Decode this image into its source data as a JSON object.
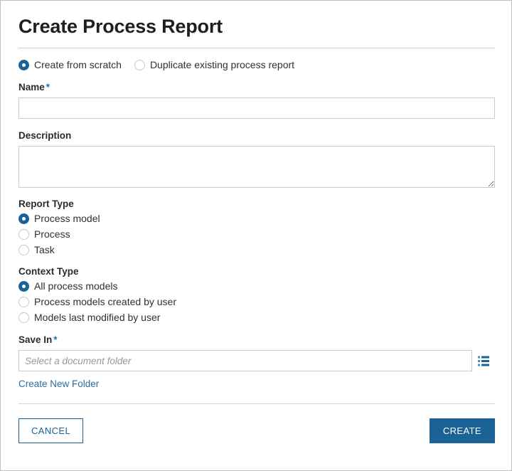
{
  "dialog": {
    "title": "Create Process Report"
  },
  "mode": {
    "options": [
      {
        "label": "Create from scratch",
        "selected": true
      },
      {
        "label": "Duplicate existing process report",
        "selected": false
      }
    ]
  },
  "name_field": {
    "label": "Name",
    "required_marker": "*",
    "value": "",
    "placeholder": ""
  },
  "description_field": {
    "label": "Description",
    "value": "",
    "placeholder": ""
  },
  "report_type": {
    "label": "Report Type",
    "options": [
      {
        "label": "Process model",
        "selected": true
      },
      {
        "label": "Process",
        "selected": false
      },
      {
        "label": "Task",
        "selected": false
      }
    ]
  },
  "context_type": {
    "label": "Context Type",
    "options": [
      {
        "label": "All process models",
        "selected": true
      },
      {
        "label": "Process models created by user",
        "selected": false
      },
      {
        "label": "Models last modified by user",
        "selected": false
      }
    ]
  },
  "save_in": {
    "label": "Save In",
    "required_marker": "*",
    "value": "",
    "placeholder": "Select a document folder",
    "picker_icon": "list-icon",
    "create_folder_link": "Create New Folder"
  },
  "footer": {
    "cancel_label": "CANCEL",
    "create_label": "CREATE"
  },
  "colors": {
    "accent": "#1b6296",
    "link": "#2c6b9b",
    "border": "#cccccc",
    "rule": "#cfcfcf",
    "text": "#2b2b2b"
  }
}
